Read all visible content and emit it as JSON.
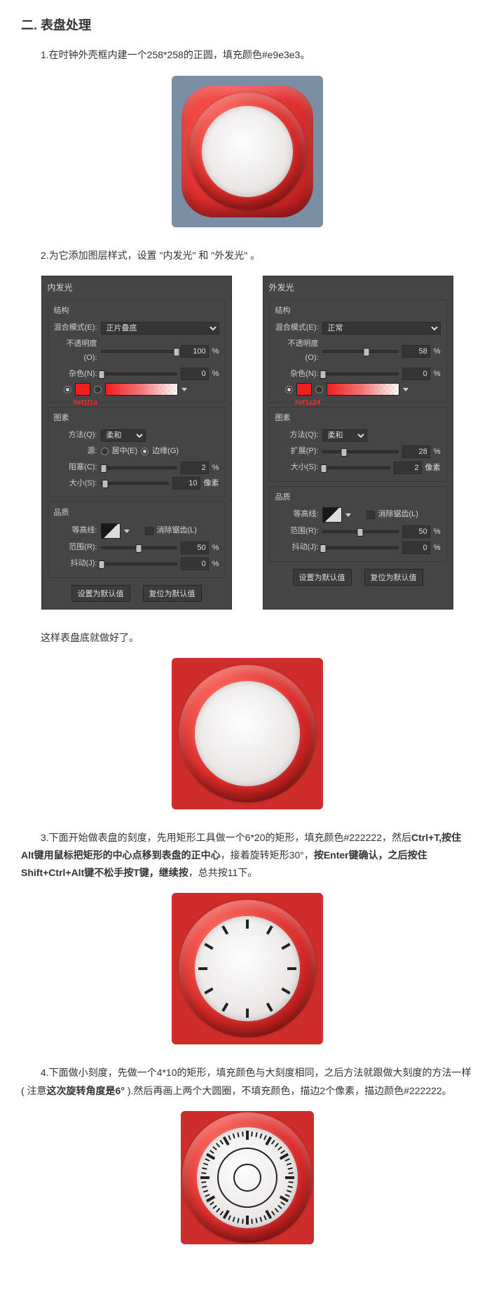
{
  "heading": "二. 表盘处理",
  "steps": {
    "s1": "1.在时钟外壳框内建一个258*258的正圆，填充颜色#e9e3e3。",
    "s2": "2.为它添加图层样式，设置 \"内发光\" 和 \"外发光\" 。",
    "s2_done": "这样表盘底就做好了。",
    "s3_a": "3.下面开始做表盘的刻度，先用矩形工具做一个6*20的矩形，填充颜色#222222，然后",
    "s3_b": "Ctrl+T,按住Alt键用鼠标把矩形的中心点移到表盘的正中心",
    "s3_c": "，接着旋转矩形30°，",
    "s3_d": "按Enter键确认，之后按住Shift+Ctrl+Alt键不松手按T键，继续按",
    "s3_e": "，总共按11下。",
    "s4_a": "4.下面做小刻度，先做一个4*10的矩形，填充颜色与大刻度相同，之后方法就跟做大刻度的方法一样 ( 注意",
    "s4_b": "这次旋转角度是6°",
    "s4_c": " ).然后再画上两个大圆圈，不填充颜色，描边2个像素，描边颜色#222222。"
  },
  "panel_inner": {
    "title": "内发光",
    "struct": "结构",
    "blend_lbl": "混合模式(E):",
    "blend_val": "正片叠底",
    "opacity_lbl": "不透明度(O):",
    "opacity_val": "100",
    "pct": "%",
    "noise_lbl": "杂色(N):",
    "noise_val": "0",
    "hex": "#ef1f1a",
    "elements_head": "图素",
    "technique_lbl": "方法(Q):",
    "technique_val": "柔和",
    "source_lbl": "源:",
    "source_center": "居中(E)",
    "source_edge": "边缘(G)",
    "choke_lbl": "阻塞(C):",
    "choke_val": "2",
    "size_lbl": "大小(S):",
    "size_val": "10",
    "px": "像素",
    "quality_head": "品质",
    "contour_lbl": "等高线:",
    "antialias": "消除锯齿(L)",
    "range_lbl": "范围(R):",
    "range_val": "50",
    "jitter_lbl": "抖动(J):",
    "jitter_val": "0",
    "btn_default": "设置为默认值",
    "btn_reset": "复位为默认值"
  },
  "panel_outer": {
    "title": "外发光",
    "struct": "结构",
    "blend_lbl": "混合模式(E):",
    "blend_val": "正常",
    "opacity_lbl": "不透明度(O):",
    "opacity_val": "58",
    "pct": "%",
    "noise_lbl": "杂色(N):",
    "noise_val": "0",
    "hex": "#ef1a24",
    "elements_head": "图素",
    "technique_lbl": "方法(Q):",
    "technique_val": "柔和",
    "spread_lbl": "扩展(P):",
    "spread_val": "28",
    "size_lbl": "大小(S):",
    "size_val": "2",
    "px": "像素",
    "quality_head": "品质",
    "contour_lbl": "等高线:",
    "antialias": "消除锯齿(L)",
    "range_lbl": "范围(R):",
    "range_val": "50",
    "jitter_lbl": "抖动(J):",
    "jitter_val": "0",
    "btn_default": "设置为默认值",
    "btn_reset": "复位为默认值"
  }
}
